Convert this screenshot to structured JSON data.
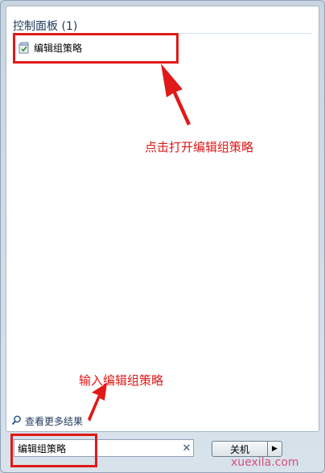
{
  "results": {
    "section_title": "控制面板 (1)",
    "items": [
      {
        "label": "编辑组策略",
        "icon": "group-policy-icon"
      }
    ]
  },
  "annotations": {
    "click_hint": "点击打开编辑组策略",
    "input_hint": "输入编辑组策略"
  },
  "see_more": {
    "label": "查看更多结果",
    "icon": "search-icon"
  },
  "search": {
    "value": "编辑组策略",
    "clear_icon": "close-icon"
  },
  "shutdown": {
    "label": "关机",
    "arrow_icon": "chevron-right-icon"
  },
  "watermark": "xuexila.com",
  "colors": {
    "annotation_red": "#e01919",
    "section_title": "#1e395b"
  }
}
